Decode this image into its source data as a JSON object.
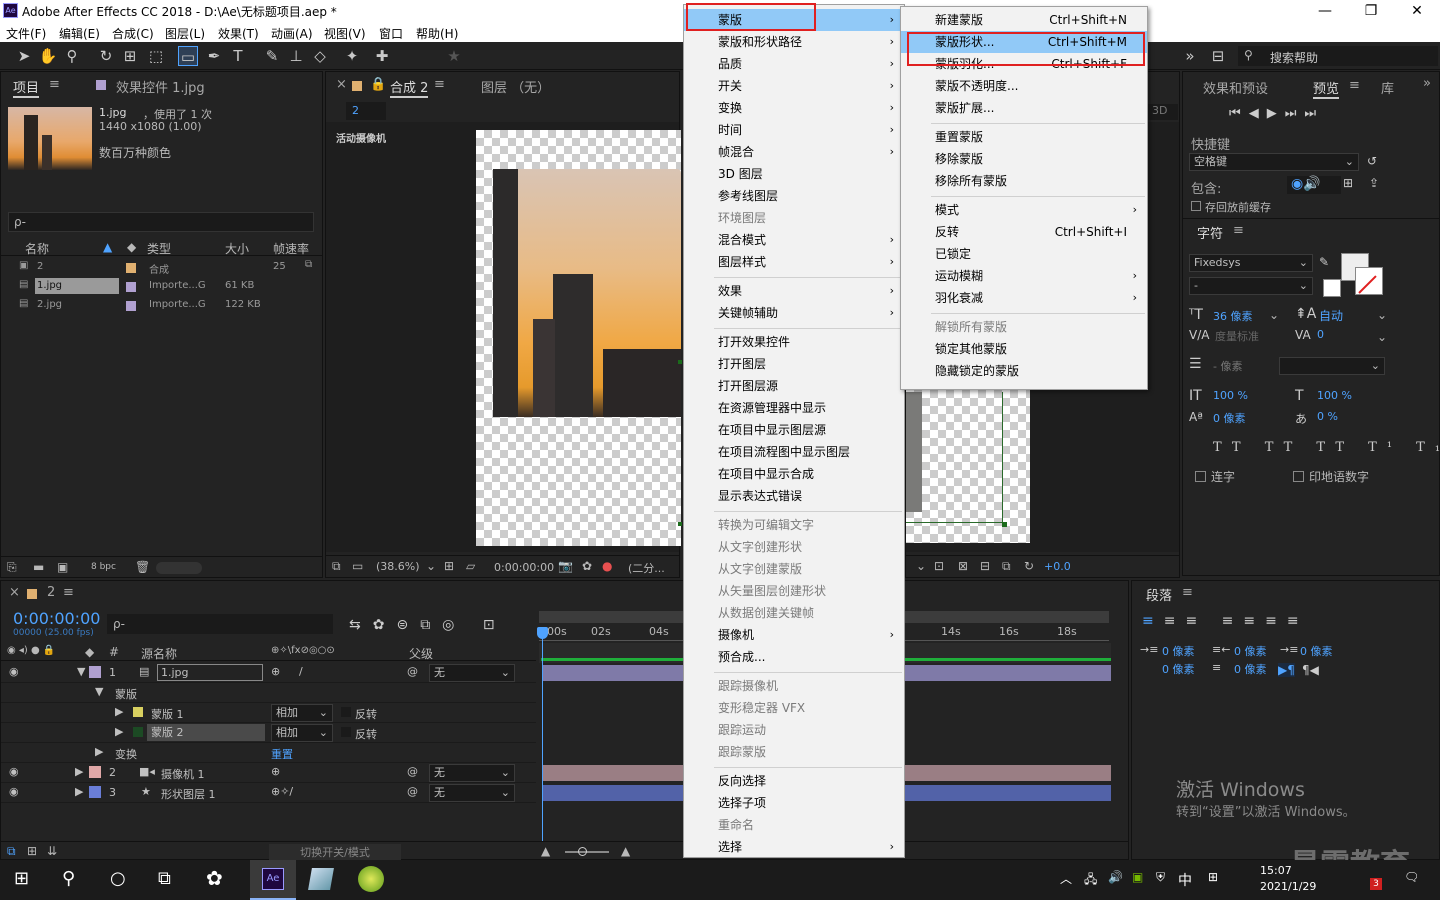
{
  "window": {
    "title": "Adobe After Effects CC 2018 - D:\\Ae\\无标题项目.aep *",
    "app_icon": "Ae",
    "minimize": "—",
    "maximize": "❐",
    "close": "✕"
  },
  "menubar": [
    "文件(F)",
    "编辑(E)",
    "合成(C)",
    "图层(L)",
    "效果(T)",
    "动画(A)",
    "视图(V)",
    "窗口",
    "帮助(H)"
  ],
  "toolbar": {
    "search_help": "搜索帮助"
  },
  "project_panel": {
    "tab": "项目",
    "tab2": "效果控件 1.jpg",
    "item_name": "1.jpg",
    "item_used": "，使用了 1 次",
    "item_dims": "1440 x1080 (1.00)",
    "item_colors": "数百万种颜色",
    "search_placeholder": "ρ-",
    "columns": [
      "名称",
      "类型",
      "大小",
      "帧速率"
    ],
    "rows": [
      {
        "name": "2",
        "type": "合成",
        "size": "",
        "fps": "25",
        "color": "#e0b070"
      },
      {
        "name": "1.jpg",
        "type": "Importe...G",
        "size": "61 KB",
        "fps": "",
        "color": "#b0a0d0"
      },
      {
        "name": "2.jpg",
        "type": "Importe...G",
        "size": "122 KB",
        "fps": "",
        "color": "#b0a0d0"
      }
    ],
    "bpc": "8 bpc"
  },
  "comp_panel": {
    "tab": "合成 2",
    "layer_tab": "图层 （无）",
    "breadcrumb": "2",
    "camera_label": "活动摄像机",
    "zoom": "(38.6%)",
    "timecode": "0:00:00:00",
    "resolution": "(二分...",
    "offset": "+0.0",
    "badge": "3D"
  },
  "layer_menu": [
    {
      "label": "蒙版",
      "arrow": true,
      "hl": true
    },
    {
      "label": "蒙版和形状路径",
      "arrow": true
    },
    {
      "label": "品质",
      "arrow": true
    },
    {
      "label": "开关",
      "arrow": true
    },
    {
      "label": "变换",
      "arrow": true
    },
    {
      "label": "时间",
      "arrow": true
    },
    {
      "label": "帧混合",
      "arrow": true
    },
    {
      "label": "3D 图层"
    },
    {
      "label": "参考线图层"
    },
    {
      "label": "环境图层",
      "dis": true
    },
    {
      "label": "混合模式",
      "arrow": true
    },
    {
      "label": "图层样式",
      "arrow": true
    },
    {
      "sep": true
    },
    {
      "label": "效果",
      "arrow": true
    },
    {
      "label": "关键帧辅助",
      "arrow": true
    },
    {
      "sep": true
    },
    {
      "label": "打开效果控件"
    },
    {
      "label": "打开图层"
    },
    {
      "label": "打开图层源"
    },
    {
      "label": "在资源管理器中显示"
    },
    {
      "label": "在项目中显示图层源"
    },
    {
      "label": "在项目流程图中显示图层"
    },
    {
      "label": "在项目中显示合成"
    },
    {
      "label": "显示表达式错误"
    },
    {
      "sep": true
    },
    {
      "label": "转换为可编辑文字",
      "dis": true
    },
    {
      "label": "从文字创建形状",
      "dis": true
    },
    {
      "label": "从文字创建蒙版",
      "dis": true
    },
    {
      "label": "从矢量图层创建形状",
      "dis": true
    },
    {
      "label": "从数据创建关键帧",
      "dis": true
    },
    {
      "label": "摄像机",
      "arrow": true
    },
    {
      "label": "预合成..."
    },
    {
      "sep": true
    },
    {
      "label": "跟踪摄像机",
      "dis": true
    },
    {
      "label": "变形稳定器 VFX",
      "dis": true
    },
    {
      "label": "跟踪运动",
      "dis": true
    },
    {
      "label": "跟踪蒙版",
      "dis": true
    },
    {
      "sep": true
    },
    {
      "label": "反向选择"
    },
    {
      "label": "选择子项"
    },
    {
      "label": "重命名",
      "dis": true
    },
    {
      "label": "选择",
      "arrow": true
    }
  ],
  "mask_menu": [
    {
      "label": "新建蒙版",
      "sc": "Ctrl+Shift+N"
    },
    {
      "label": "蒙版形状...",
      "sc": "Ctrl+Shift+M",
      "hl": true
    },
    {
      "label": "蒙版羽化...",
      "sc": "Ctrl+Shift+F"
    },
    {
      "label": "蒙版不透明度..."
    },
    {
      "label": "蒙版扩展..."
    },
    {
      "sep": true
    },
    {
      "label": "重置蒙版"
    },
    {
      "label": "移除蒙版"
    },
    {
      "label": "移除所有蒙版"
    },
    {
      "sep": true
    },
    {
      "label": "模式",
      "arrow": true
    },
    {
      "label": "反转",
      "sc": "Ctrl+Shift+I"
    },
    {
      "label": "已锁定"
    },
    {
      "label": "运动模糊",
      "arrow": true
    },
    {
      "label": "羽化衰减",
      "arrow": true
    },
    {
      "sep": true
    },
    {
      "label": "解锁所有蒙版",
      "dis": true
    },
    {
      "label": "锁定其他蒙版"
    },
    {
      "label": "隐藏锁定的蒙版"
    }
  ],
  "right_panel": {
    "tabs": [
      "效果和预设",
      "预览",
      "库"
    ],
    "shortcut_label": "快捷键",
    "shortcut_value": "空格键",
    "include_label": "包含:",
    "cache_label": "存回放前缓存",
    "char_tab": "字符",
    "font": "Fixedsys",
    "font_style": "-",
    "size_val": "36 像素",
    "leading": "自动",
    "tracking_label": "度量标准",
    "tracking_val": "0",
    "stroke_val": "- 像素",
    "vscale": "100 %",
    "hscale": "100 %",
    "baseline": "0 像素",
    "tsume": "0 %",
    "ligature": "连字",
    "hindi": "印地语数字",
    "para_tab": "段落",
    "px0": "0 像素"
  },
  "timeline": {
    "tab": "2",
    "timecode": "0:00:00:00",
    "frames": "00000 (25.00 fps)",
    "columns": [
      "#",
      "源名称",
      "父级"
    ],
    "ruler": [
      "00s",
      "02s",
      "04s",
      "14s",
      "16s",
      "18s"
    ],
    "layers": [
      {
        "num": "1",
        "name": "1.jpg",
        "parent": "无",
        "color": "#b0a0d0"
      },
      {
        "indent": "蒙版"
      },
      {
        "mask": "蒙版 1",
        "mode": "相加",
        "inv": "反转"
      },
      {
        "mask": "蒙版 2",
        "mode": "相加",
        "inv": "反转"
      },
      {
        "indent": "变换",
        "reset": "重置"
      },
      {
        "num": "2",
        "name": "摄像机 1",
        "parent": "无",
        "color": "#e0a8a8"
      },
      {
        "num": "3",
        "name": "形状图层 1",
        "parent": "无",
        "color": "#6a7ed8"
      }
    ],
    "footer": "切换开关/模式"
  },
  "watermark": {
    "line1": "激活 Windows",
    "line2": "转到“设置”以激活 Windows。",
    "brand": "最需教育"
  },
  "taskbar": {
    "time": "15:07",
    "date": "2021/1/29",
    "ime": "中",
    "badge": "3"
  },
  "colors": {
    "accent": "#91c9f7",
    "highlight_box": "#e02020",
    "timecode": "#4fa3ff"
  }
}
